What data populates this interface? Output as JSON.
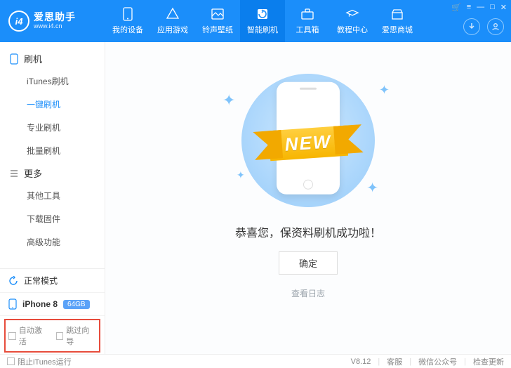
{
  "brand": {
    "name": "爱思助手",
    "domain": "www.i4.cn",
    "logo_text": "i4"
  },
  "window_controls": [
    "🛒",
    "≡",
    "—",
    "□",
    "✕"
  ],
  "nav": [
    {
      "key": "device",
      "label": "我的设备"
    },
    {
      "key": "apps",
      "label": "应用游戏"
    },
    {
      "key": "ringtone",
      "label": "铃声壁纸"
    },
    {
      "key": "flash",
      "label": "智能刷机",
      "active": true
    },
    {
      "key": "toolbox",
      "label": "工具箱"
    },
    {
      "key": "tutorial",
      "label": "教程中心"
    },
    {
      "key": "mall",
      "label": "爱思商城"
    }
  ],
  "sidebar": {
    "groups": [
      {
        "title": "刷机",
        "items": [
          {
            "label": "iTunes刷机"
          },
          {
            "label": "一键刷机",
            "active": true
          },
          {
            "label": "专业刷机"
          },
          {
            "label": "批量刷机"
          }
        ]
      },
      {
        "title": "更多",
        "items": [
          {
            "label": "其他工具"
          },
          {
            "label": "下载固件"
          },
          {
            "label": "高级功能"
          }
        ]
      }
    ],
    "mode": "正常模式",
    "device": {
      "name": "iPhone 8",
      "storage": "64GB"
    },
    "checks": [
      {
        "label": "自动激活"
      },
      {
        "label": "跳过向导"
      }
    ]
  },
  "main": {
    "ribbon": "NEW",
    "success_msg": "恭喜您，保资料刷机成功啦！",
    "ok": "确定",
    "view_log": "查看日志"
  },
  "footer": {
    "block_itunes": "阻止iTunes运行",
    "version": "V8.12",
    "support": "客服",
    "wechat": "微信公众号",
    "update": "检查更新"
  }
}
